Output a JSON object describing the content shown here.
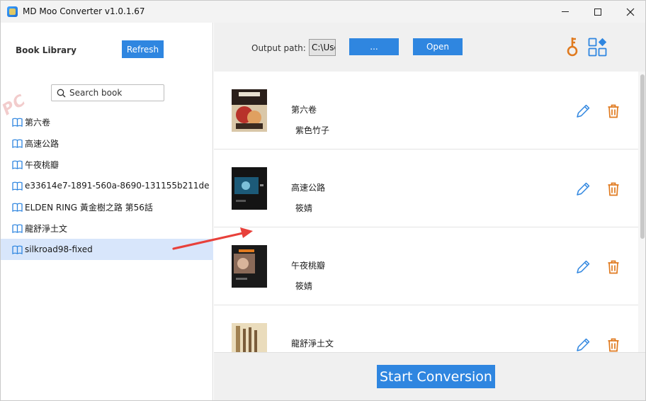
{
  "window": {
    "title": "MD Moo Converter v1.0.1.67"
  },
  "sidebar": {
    "heading": "Book Library",
    "refresh_label": "Refresh",
    "search_placeholder": "Search book",
    "items": [
      {
        "label": "第六卷"
      },
      {
        "label": "高速公路"
      },
      {
        "label": "午夜桃瓣"
      },
      {
        "label": "e33614e7-1891-560a-8690-131155b211de"
      },
      {
        "label": "ELDEN RING 黃金樹之路 第56話"
      },
      {
        "label": "龍舒淨土文"
      },
      {
        "label": "silkroad98-fixed",
        "selected": true
      }
    ]
  },
  "toolbar": {
    "output_label": "Output path:",
    "output_value": "C:\\Use",
    "browse_label": "...",
    "open_label": "Open",
    "icons": [
      "key-icon",
      "apps-grid-icon"
    ]
  },
  "books": [
    {
      "title": "第六卷",
      "author": "紫色竹子"
    },
    {
      "title": "高速公路",
      "author": "筱婧"
    },
    {
      "title": "午夜桃瓣",
      "author": "筱婧"
    },
    {
      "title": "龍舒淨土文",
      "author": ""
    }
  ],
  "footer": {
    "start_label": "Start Conversion"
  },
  "watermark": "PC",
  "colors": {
    "accent": "#2f86e0",
    "selected_row": "#d8e6fb",
    "action_orange": "#e07a1f",
    "edit_blue": "#2f86e0",
    "annotation_red": "#e8413b"
  }
}
